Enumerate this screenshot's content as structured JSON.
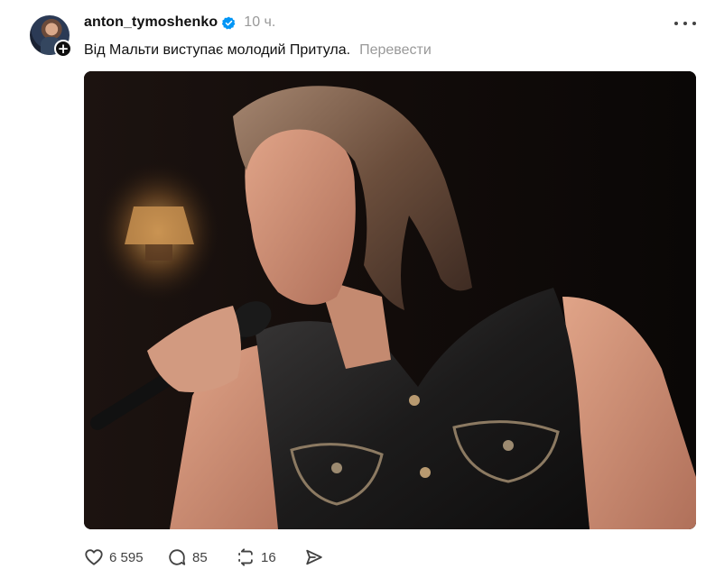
{
  "post": {
    "username": "anton_tymoshenko",
    "time": "10 ч.",
    "caption": "Від Мальти виступає молодий Притула.",
    "translate_label": "Перевести",
    "stats": {
      "likes": "6 595",
      "replies": "85",
      "reposts": "16"
    }
  },
  "icons": {
    "avatar": "avatar",
    "follow": "plus-icon",
    "verified": "verified-badge-icon",
    "more": "more-options-icon",
    "like": "heart-icon",
    "reply": "comment-bubble-icon",
    "repost": "repost-icon",
    "share": "send-icon"
  },
  "colors": {
    "verified": "#0095f6",
    "muted": "#999999",
    "text": "#101010"
  }
}
